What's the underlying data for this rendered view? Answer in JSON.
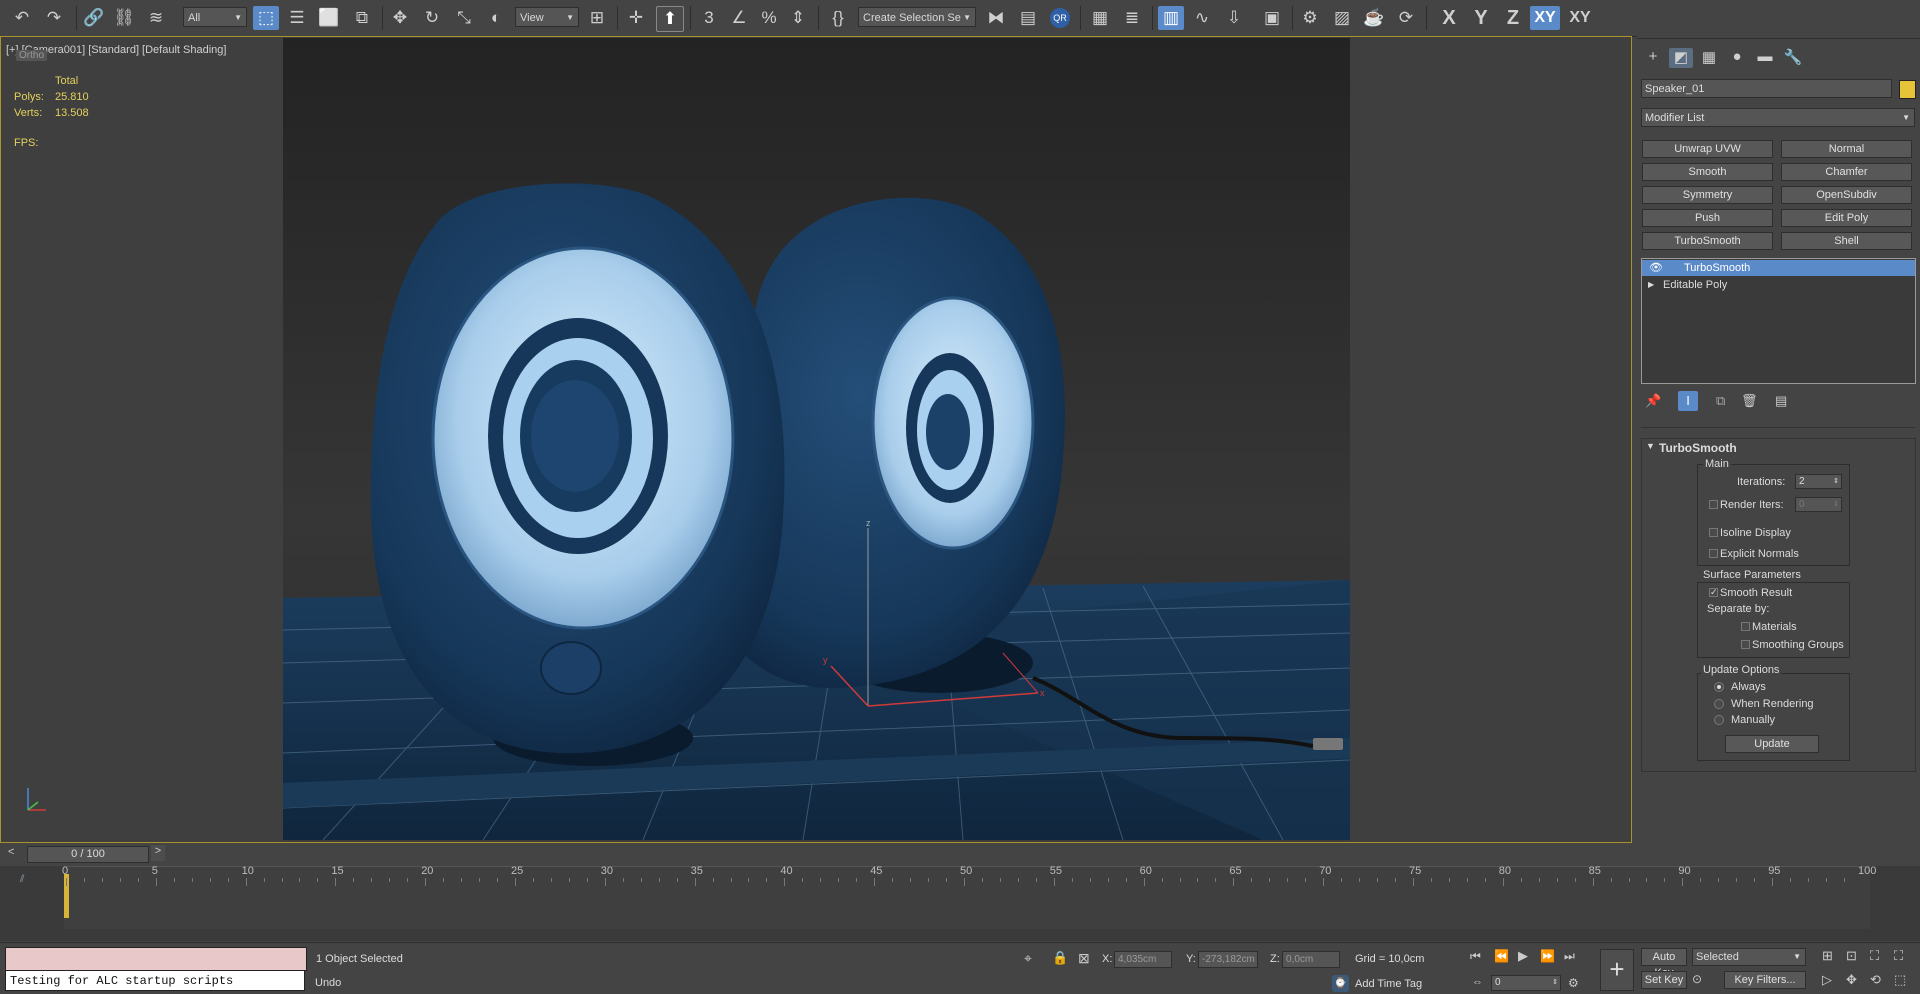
{
  "toolbar": {
    "filter_select": "All",
    "ref_coord_select": "View",
    "selection_set_select": "Create Selection Se",
    "axis_x": "X",
    "axis_y": "Y",
    "axis_z": "Z",
    "axis_xy": "XY",
    "axis_xy2": "XY",
    "qr_badge": "QR"
  },
  "viewport": {
    "label": "[+] [Camera001] [Standard] [Default Shading]",
    "overlay_label": "Ortho",
    "stats_total": "Total",
    "polys_label": "Polys:",
    "polys_value": "25.810",
    "verts_label": "Verts:",
    "verts_value": "13.508",
    "fps_label": "FPS:",
    "gizmo_x": "x",
    "gizmo_y": "y",
    "gizmo_z": "z"
  },
  "panel": {
    "object_name": "Speaker_01",
    "object_color": "#e6c339",
    "modifier_list": "Modifier List",
    "modifier_buttons": [
      "Unwrap UVW",
      "Normal",
      "Smooth",
      "Chamfer",
      "Symmetry",
      "OpenSubdiv",
      "Push",
      "Edit Poly",
      "TurboSmooth",
      "Shell"
    ],
    "stack": [
      "TurboSmooth",
      "Editable Poly"
    ],
    "rollout_title": "TurboSmooth",
    "main_group": "Main",
    "iterations_label": "Iterations:",
    "iterations_value": "2",
    "render_iters_label": "Render Iters:",
    "render_iters_value": "0",
    "isoline_label": "Isoline Display",
    "explicit_normals_label": "Explicit Normals",
    "surface_group": "Surface Parameters",
    "smooth_result_label": "Smooth Result",
    "separate_by_label": "Separate by:",
    "materials_label": "Materials",
    "smoothing_groups_label": "Smoothing Groups",
    "update_group": "Update Options",
    "always_label": "Always",
    "when_rendering_label": "When Rendering",
    "manually_label": "Manually",
    "update_button": "Update"
  },
  "timeline": {
    "frame_counter": "0 / 100",
    "ticks": [
      "0",
      "5",
      "10",
      "15",
      "20",
      "25",
      "30",
      "35",
      "40",
      "45",
      "50",
      "55",
      "60",
      "65",
      "70",
      "75",
      "80",
      "85",
      "90",
      "95",
      "100"
    ]
  },
  "status": {
    "script_output": "Testing for ALC startup scripts",
    "selection_msg": "1 Object Selected",
    "undo_msg": "Undo",
    "x_label": "X:",
    "x_value": "4,035cm",
    "y_label": "Y:",
    "y_value": "-273,182cm",
    "z_label": "Z:",
    "z_value": "0,0cm",
    "grid": "Grid = 10,0cm",
    "add_time_tag": "Add Time Tag",
    "auto_key": "Auto Key",
    "set_key": "Set Key",
    "selected_select": "Selected",
    "key_filters": "Key Filters...",
    "current_frame": "0"
  }
}
